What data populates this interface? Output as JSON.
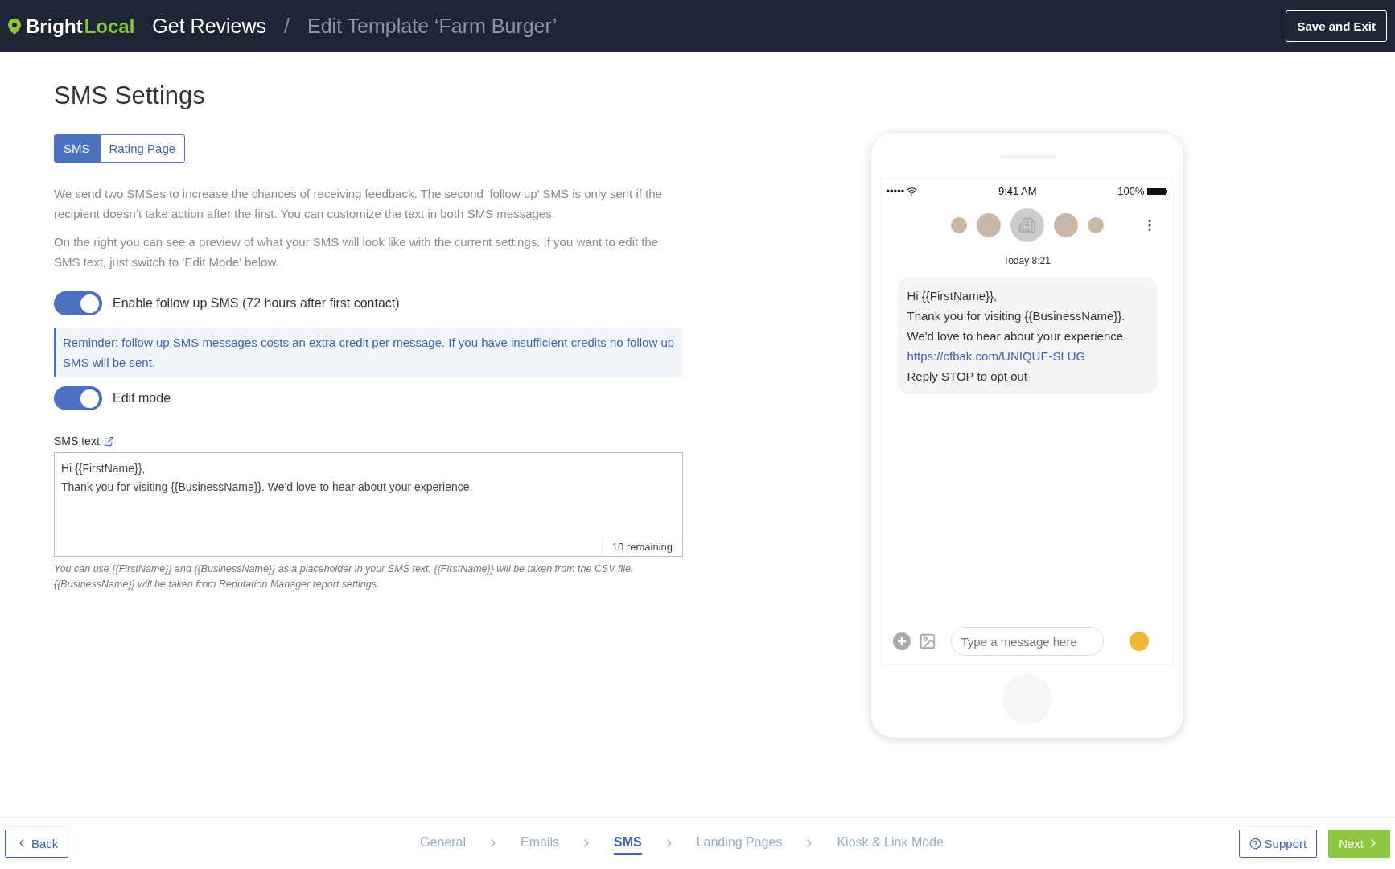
{
  "header": {
    "logo_parts": [
      "Bright",
      "Local"
    ],
    "section": "Get Reviews",
    "separator": "/",
    "page_title": "Edit Template ‘Farm Burger’",
    "save_button": "Save and Exit"
  },
  "heading": "SMS Settings",
  "tabs": [
    {
      "label": "SMS",
      "selected": true
    },
    {
      "label": "Rating Page",
      "selected": false
    }
  ],
  "paragraphs": [
    "We send two SMSes to increase the chances of receiving feedback. The second ‘follow up’ SMS is only sent if the recipient doesn’t take action after the first. You can customize the text in both SMS messages.",
    "On the right you can see a preview of what your SMS will look like with the current settings. If you want to edit the SMS text, just switch to ‘Edit Mode’ below."
  ],
  "follow_up_toggle": {
    "label": "Enable follow up SMS (72 hours after first contact)",
    "on": true
  },
  "reminder": "Reminder: follow up SMS messages costs an extra credit per message. If you have insufficient credits no follow up SMS will be sent.",
  "edit_mode_toggle": {
    "label": "Edit mode",
    "on": true
  },
  "sms_text": {
    "label": "SMS text",
    "value": "Hi {{FirstName}},\nThank you for visiting {{BusinessName}}. We'd love to hear about your experience.",
    "remaining": "10 remaining",
    "help": "You can use {{FirstName}} and {{BusinessName}} as a placeholder in your SMS text. {{FirstName}} will be taken from the CSV file. {{BusinessName}} will be taken from Reputation Manager report settings."
  },
  "phone": {
    "signal": "•••••",
    "time": "9:41 AM",
    "battery": "100%",
    "timestamp": "Today 8:21",
    "message_lines": [
      {
        "kind": "text",
        "text": "Hi {{FirstName}},"
      },
      {
        "kind": "text",
        "text": "Thank you for visiting {{BusinessName}}."
      },
      {
        "kind": "text",
        "text": "We'd love to hear about your experience."
      },
      {
        "kind": "link",
        "text": "https://cfbak.com/UNIQUE-SLUG"
      },
      {
        "kind": "text",
        "text": "Reply STOP to opt out"
      }
    ],
    "input_placeholder": "Type a message here"
  },
  "footer": {
    "back": "Back",
    "steps": [
      {
        "label": "General",
        "selected": false
      },
      {
        "label": "Emails",
        "selected": false
      },
      {
        "label": "SMS",
        "selected": true
      },
      {
        "label": "Landing Pages",
        "selected": false
      },
      {
        "label": "Kiosk & Link Mode",
        "selected": false
      }
    ],
    "support": "Support",
    "next": "Next"
  }
}
